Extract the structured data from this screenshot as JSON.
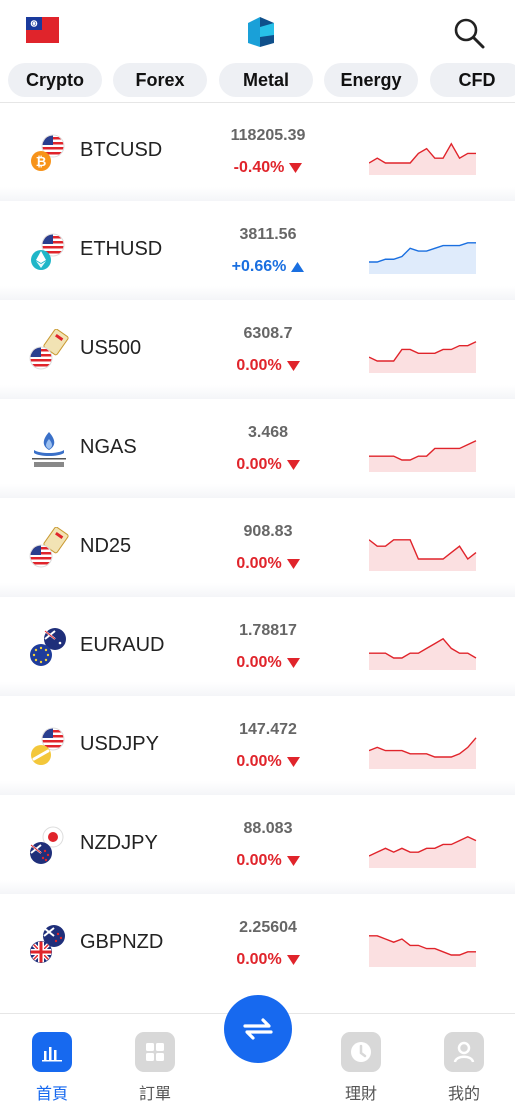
{
  "header": {
    "flag_icon": "taiwan-flag-icon",
    "logo_icon": "app-logo-icon",
    "search_icon": "search-icon"
  },
  "tabs": [
    {
      "label": "Crypto"
    },
    {
      "label": "Forex"
    },
    {
      "label": "Metal"
    },
    {
      "label": "Energy"
    },
    {
      "label": "CFD"
    }
  ],
  "colors": {
    "up": "#1a6fe0",
    "down": "#e0242b",
    "accent": "#1769ef"
  },
  "quotes": [
    {
      "symbol": "BTCUSD",
      "price": "118205.39",
      "change": "-0.40%",
      "direction": "down",
      "icon": "bitcoin-usd-icon",
      "spark": [
        3,
        4,
        3,
        3,
        3,
        3,
        5,
        6,
        4,
        4,
        7,
        4,
        5,
        5
      ]
    },
    {
      "symbol": "ETHUSD",
      "price": "3811.56",
      "change": "+0.66%",
      "direction": "up",
      "icon": "ethereum-usd-icon",
      "spark": [
        2,
        2,
        3,
        3,
        4,
        7,
        6,
        6,
        7,
        8,
        8,
        8,
        9,
        9
      ]
    },
    {
      "symbol": "US500",
      "price": "6308.7",
      "change": "0.00%",
      "direction": "down",
      "icon": "us500-icon",
      "spark": [
        3,
        2,
        2,
        2,
        5,
        5,
        4,
        4,
        4,
        5,
        5,
        6,
        6,
        7
      ]
    },
    {
      "symbol": "NGAS",
      "price": "3.468",
      "change": "0.00%",
      "direction": "down",
      "icon": "natural-gas-icon",
      "spark": [
        3,
        3,
        3,
        3,
        2,
        2,
        3,
        3,
        5,
        5,
        5,
        5,
        6,
        7
      ]
    },
    {
      "symbol": "ND25",
      "price": "908.83",
      "change": "0.00%",
      "direction": "down",
      "icon": "nd25-icon",
      "spark": [
        6,
        5,
        5,
        6,
        6,
        6,
        3,
        3,
        3,
        3,
        4,
        5,
        3,
        4
      ]
    },
    {
      "symbol": "EURAUD",
      "price": "1.78817",
      "change": "0.00%",
      "direction": "down",
      "icon": "eur-aud-icon",
      "spark": [
        3,
        3,
        3,
        2,
        2,
        3,
        3,
        4,
        5,
        6,
        4,
        3,
        3,
        2
      ]
    },
    {
      "symbol": "USDJPY",
      "price": "147.472",
      "change": "0.00%",
      "direction": "down",
      "icon": "usd-jpy-icon",
      "spark": [
        3,
        4,
        3,
        3,
        3,
        2,
        2,
        2,
        1,
        1,
        1,
        2,
        4,
        7
      ]
    },
    {
      "symbol": "NZDJPY",
      "price": "88.083",
      "change": "0.00%",
      "direction": "down",
      "icon": "nzd-jpy-icon",
      "spark": [
        1,
        2,
        3,
        2,
        3,
        2,
        2,
        3,
        3,
        4,
        4,
        5,
        6,
        5
      ]
    },
    {
      "symbol": "GBPNZD",
      "price": "2.25604",
      "change": "0.00%",
      "direction": "down",
      "icon": "gbp-nzd-icon",
      "spark": [
        8,
        8,
        7,
        6,
        7,
        5,
        5,
        4,
        4,
        3,
        2,
        2,
        3,
        3
      ]
    }
  ],
  "bottom_nav": [
    {
      "label": "首頁",
      "icon": "home-chart-icon",
      "active": true
    },
    {
      "label": "訂單",
      "icon": "orders-grid-icon",
      "active": false
    },
    {
      "label": "理財",
      "icon": "finance-clock-icon",
      "active": false
    },
    {
      "label": "我的",
      "icon": "profile-icon",
      "active": false
    }
  ],
  "fab": {
    "icon": "exchange-arrows-icon"
  }
}
